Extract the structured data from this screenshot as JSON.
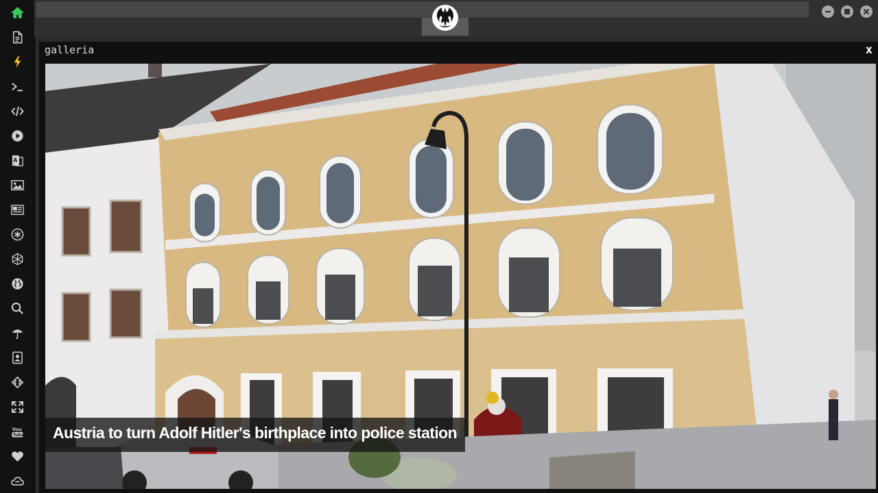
{
  "sidebar": {
    "items": [
      {
        "icon": "home-icon",
        "active": true
      },
      {
        "icon": "document-icon"
      },
      {
        "icon": "lightning-icon"
      },
      {
        "icon": "terminal-icon"
      },
      {
        "icon": "code-icon"
      },
      {
        "icon": "play-icon"
      },
      {
        "icon": "translate-icon"
      },
      {
        "icon": "image-icon"
      },
      {
        "icon": "news-icon"
      },
      {
        "icon": "asterisk-icon"
      },
      {
        "icon": "hexagon-icon"
      },
      {
        "icon": "globe-icon"
      },
      {
        "icon": "search-icon"
      },
      {
        "icon": "umbrella-icon"
      },
      {
        "icon": "contacts-icon"
      },
      {
        "icon": "dev-tools-icon"
      },
      {
        "icon": "expand-icon"
      },
      {
        "icon": "youtube-icon"
      },
      {
        "icon": "heart-icon"
      },
      {
        "icon": "cloud-icon"
      }
    ],
    "accent": "#39c75a"
  },
  "topbar": {
    "emblem_icon": "rebel-alliance-icon",
    "window_controls": [
      "minimize-icon",
      "maximize-icon",
      "close-icon"
    ]
  },
  "gallery": {
    "title": "galleria",
    "close_label": "x",
    "caption": "Austria to turn Adolf Hitler's birthplace into police station"
  }
}
